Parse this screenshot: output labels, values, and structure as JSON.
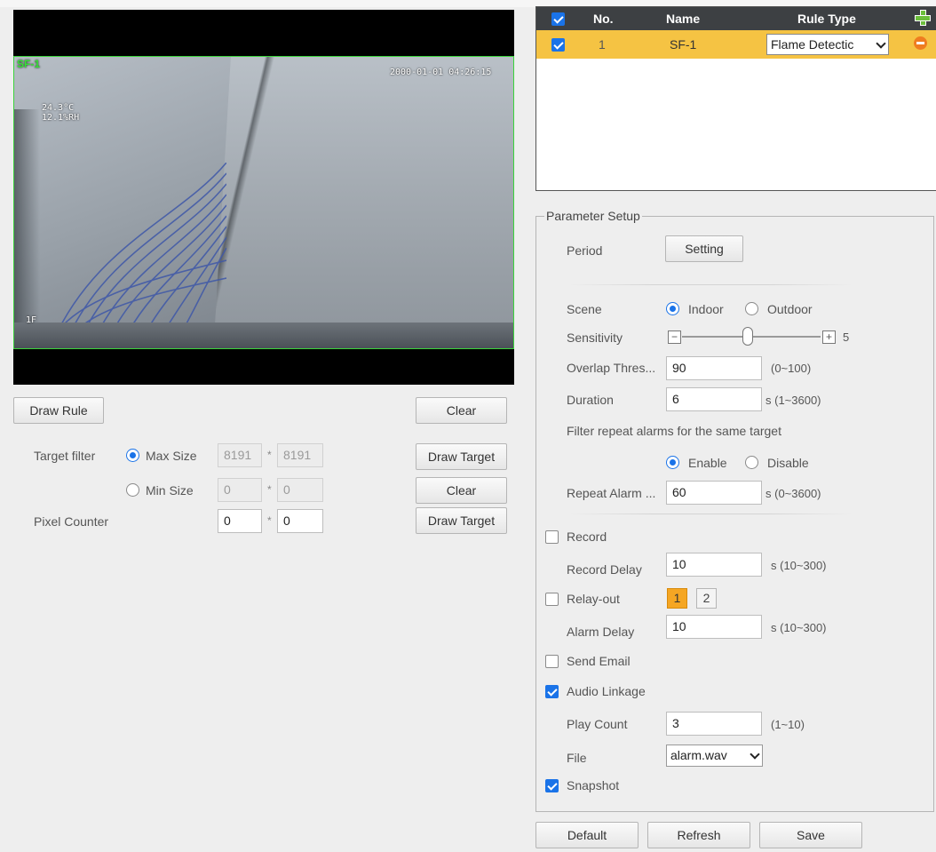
{
  "video": {
    "rule_label": "SF-1",
    "timestamp": "2000-01-01 04:26:15",
    "temp_line1": "24.3°C",
    "temp_line2": "12.1%RH",
    "channel_label": "1F"
  },
  "left": {
    "draw_rule": "Draw Rule",
    "clear": "Clear",
    "target_filter_label": "Target filter",
    "max_size_label": "Max Size",
    "max_w": "8191",
    "max_h": "8191",
    "min_size_label": "Min Size",
    "min_w": "0",
    "min_h": "0",
    "pixel_counter_label": "Pixel Counter",
    "pix_w": "0",
    "pix_h": "0",
    "draw_target_1": "Draw Target",
    "clear_2": "Clear",
    "draw_target_2": "Draw Target",
    "star": "*"
  },
  "table": {
    "headers": {
      "no": "No.",
      "name": "Name",
      "type": "Rule Type"
    },
    "rows": [
      {
        "checked": true,
        "no": "1",
        "name": "SF-1",
        "type": "Flame Detectic"
      }
    ]
  },
  "params": {
    "legend": "Parameter Setup",
    "period_label": "Period",
    "setting_btn": "Setting",
    "scene_label": "Scene",
    "indoor": "Indoor",
    "outdoor": "Outdoor",
    "scene_value": "Indoor",
    "sensitivity_label": "Sensitivity",
    "sensitivity_value": "5",
    "overlap_label": "Overlap Thres...",
    "overlap_value": "90",
    "overlap_range": "(0~100)",
    "duration_label": "Duration",
    "duration_value": "6",
    "duration_range": "s (1~3600)",
    "filter_text": "Filter repeat alarms for the same target",
    "enable": "Enable",
    "disable": "Disable",
    "repeat_label": "Repeat Alarm ...",
    "repeat_value": "60",
    "repeat_range": "s (0~3600)",
    "record_label": "Record",
    "record_checked": false,
    "record_delay_label": "Record Delay",
    "record_delay_value": "10",
    "record_delay_range": "s (10~300)",
    "relay_label": "Relay-out",
    "relay_checked": false,
    "relay_1": "1",
    "relay_2": "2",
    "alarm_delay_label": "Alarm Delay",
    "alarm_delay_value": "10",
    "alarm_delay_range": "s (10~300)",
    "email_label": "Send Email",
    "email_checked": false,
    "audio_label": "Audio Linkage",
    "audio_checked": true,
    "play_count_label": "Play Count",
    "play_count_value": "3",
    "play_count_range": "(1~10)",
    "file_label": "File",
    "file_value": "alarm.wav",
    "snapshot_label": "Snapshot",
    "snapshot_checked": true
  },
  "footer": {
    "default": "Default",
    "refresh": "Refresh",
    "save": "Save"
  },
  "colors": {
    "accent": "#1a73e8",
    "row_highlight": "#f5c343",
    "header": "#3d4043",
    "rule_box": "#3bd33b"
  }
}
